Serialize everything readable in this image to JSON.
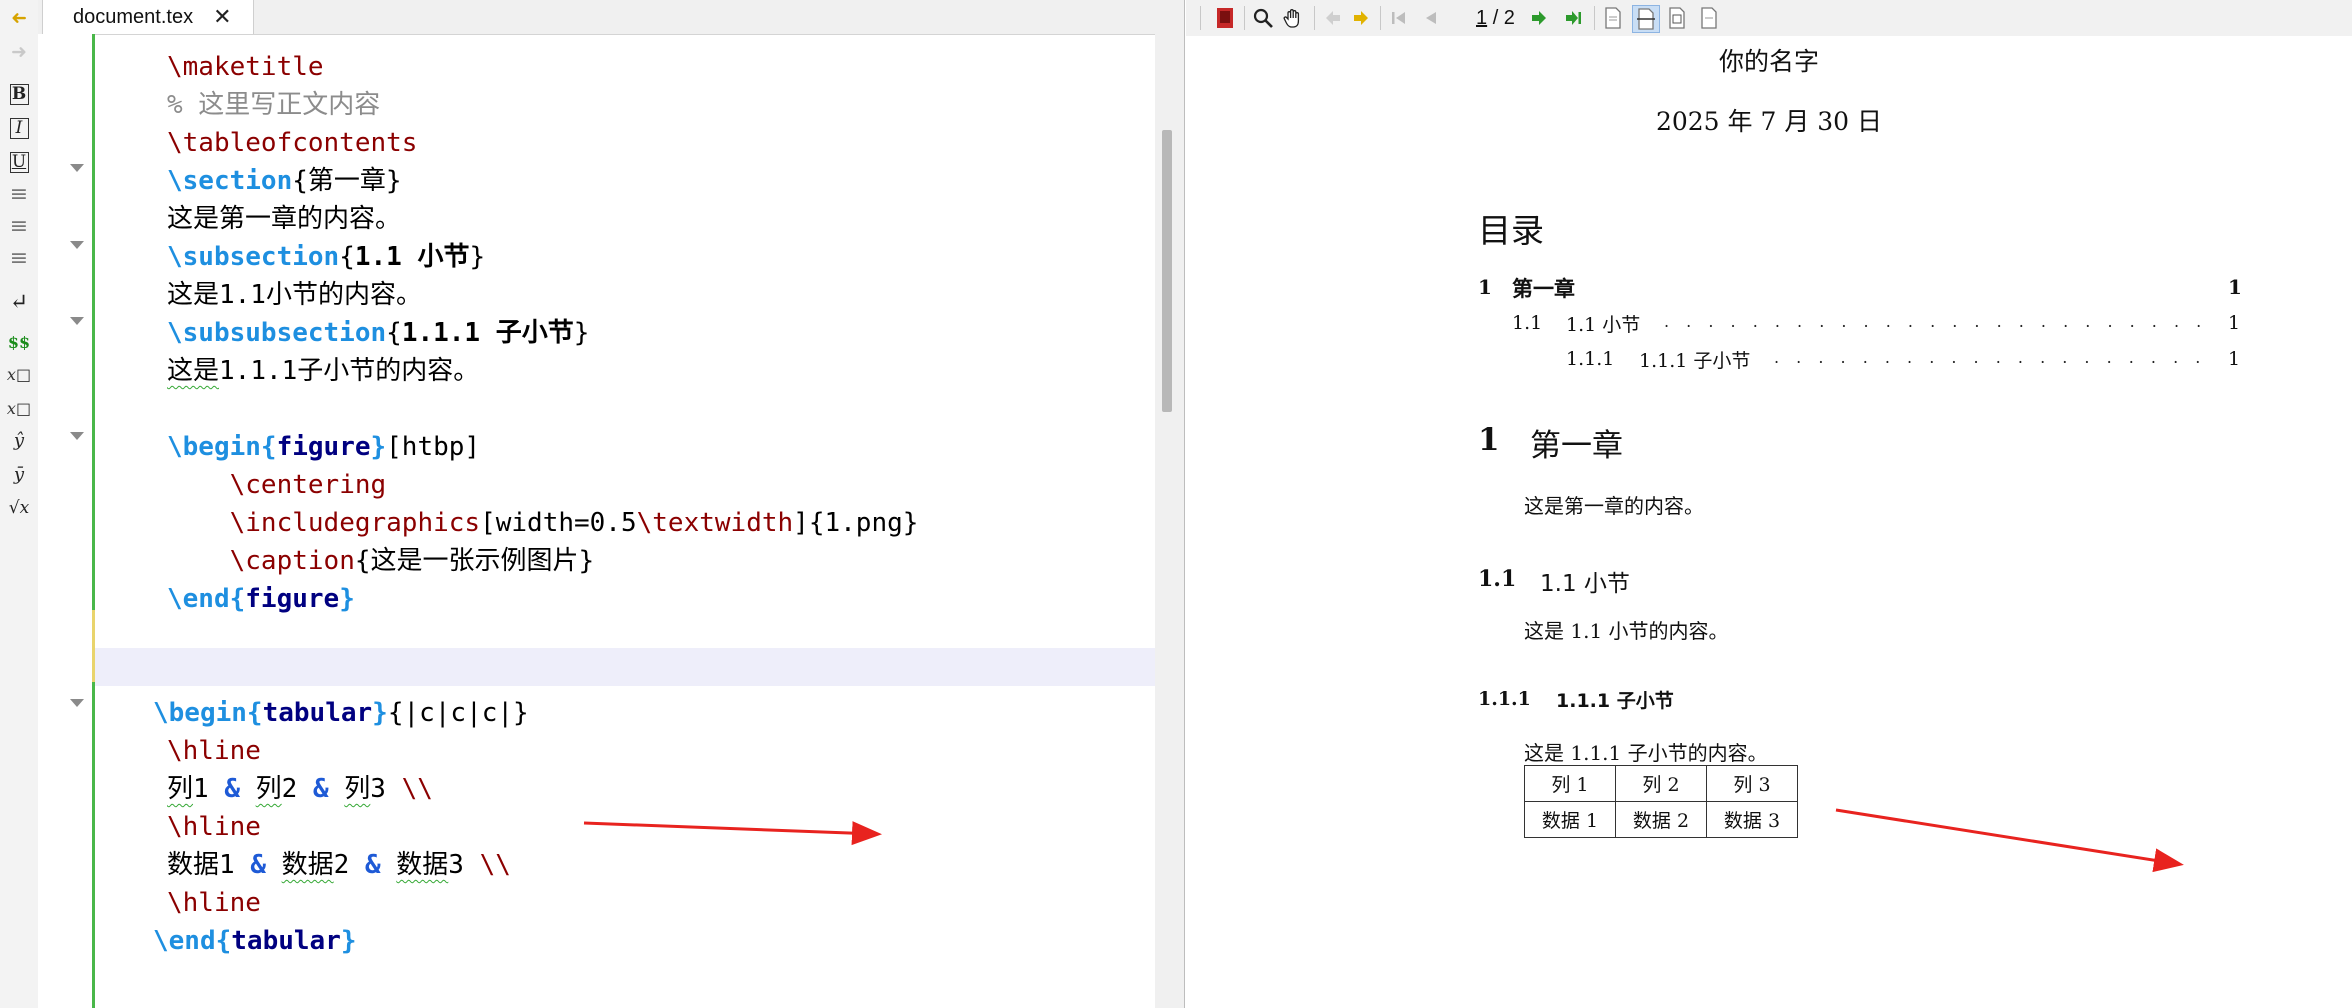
{
  "tab": {
    "filename": "document.tex",
    "close_glyph": "✕"
  },
  "left_toolbar": {
    "items": [
      {
        "name": "back-arrow-icon",
        "glyph": "➜"
      },
      {
        "name": "forward-arrow-icon",
        "glyph": "➜"
      },
      {
        "name": "bold-icon",
        "glyph": "B"
      },
      {
        "name": "italic-icon",
        "glyph": "I"
      },
      {
        "name": "underline-icon",
        "glyph": "U"
      },
      {
        "name": "align-left-icon",
        "glyph": "≡"
      },
      {
        "name": "align-center-icon",
        "glyph": "≡"
      },
      {
        "name": "align-right-icon",
        "glyph": "≡"
      },
      {
        "name": "newline-icon",
        "glyph": "↵"
      },
      {
        "name": "math-dollar-icon",
        "glyph": "$$"
      },
      {
        "name": "subscript-icon",
        "glyph": "x□"
      },
      {
        "name": "superscript-icon",
        "glyph": "x□"
      },
      {
        "name": "hat-icon",
        "glyph": "ŷ"
      },
      {
        "name": "bar-icon",
        "glyph": "ȳ"
      },
      {
        "name": "sqrt-icon",
        "glyph": "√x"
      }
    ]
  },
  "editor": {
    "lines": [
      [
        {
          "t": "\\maketitle",
          "c": "cmd"
        }
      ],
      [
        {
          "t": "% 这里写正文内容",
          "c": "cmt"
        }
      ],
      [
        {
          "t": "\\tableofcontents",
          "c": "cmd"
        }
      ],
      [
        {
          "t": "\\section",
          "c": "kw"
        },
        {
          "t": "{",
          "c": ""
        },
        {
          "t": "第一章",
          "c": ""
        },
        {
          "t": "}",
          "c": ""
        }
      ],
      [
        {
          "t": "这是第一章的内容。",
          "c": ""
        }
      ],
      [
        {
          "t": "\\subsection",
          "c": "kw"
        },
        {
          "t": "{",
          "c": ""
        },
        {
          "t": "1.1 小节",
          "c": "bold"
        },
        {
          "t": "}",
          "c": ""
        }
      ],
      [
        {
          "t": "这是1.1小节的内容。",
          "c": ""
        }
      ],
      [
        {
          "t": "\\subsubsection",
          "c": "kw"
        },
        {
          "t": "{",
          "c": ""
        },
        {
          "t": "1.1.1 子小节",
          "c": "bold"
        },
        {
          "t": "}",
          "c": ""
        }
      ],
      [
        {
          "t": "这是",
          "c": "sq"
        },
        {
          "t": "1.1.1子小节的内容。",
          "c": ""
        }
      ],
      [],
      [
        {
          "t": "\\begin",
          "c": "kw"
        },
        {
          "t": "{",
          "c": "kw"
        },
        {
          "t": "figure",
          "c": "env"
        },
        {
          "t": "}",
          "c": "kw"
        },
        {
          "t": "[htbp]",
          "c": ""
        }
      ],
      [
        {
          "t": "    ",
          "c": ""
        },
        {
          "t": "\\centering",
          "c": "cmd"
        }
      ],
      [
        {
          "t": "    ",
          "c": ""
        },
        {
          "t": "\\includegraphics",
          "c": "cmd"
        },
        {
          "t": "[width=0.5",
          "c": ""
        },
        {
          "t": "\\textwidth",
          "c": "cmd"
        },
        {
          "t": "]{1.png}",
          "c": ""
        }
      ],
      [
        {
          "t": "    ",
          "c": ""
        },
        {
          "t": "\\caption",
          "c": "cmd"
        },
        {
          "t": "{这是一张示例图片}",
          "c": ""
        }
      ],
      [
        {
          "t": "\\end",
          "c": "kw"
        },
        {
          "t": "{",
          "c": "kw"
        },
        {
          "t": "figure",
          "c": "env"
        },
        {
          "t": "}",
          "c": "kw"
        }
      ],
      [],
      [],
      [
        {
          "t": "\\begin",
          "c": "kw"
        },
        {
          "t": "{",
          "c": "kw"
        },
        {
          "t": "tabular",
          "c": "env"
        },
        {
          "t": "}",
          "c": "kw"
        },
        {
          "t": "{|c|c|c|}",
          "c": ""
        }
      ],
      [
        {
          "t": "\\hline",
          "c": "cmd"
        }
      ],
      [
        {
          "t": "列",
          "c": "sq"
        },
        {
          "t": "1 ",
          "c": ""
        },
        {
          "t": "&",
          "c": "amp"
        },
        {
          "t": " ",
          "c": ""
        },
        {
          "t": "列",
          "c": "sq"
        },
        {
          "t": "2 ",
          "c": ""
        },
        {
          "t": "&",
          "c": "amp"
        },
        {
          "t": " ",
          "c": ""
        },
        {
          "t": "列",
          "c": "sq"
        },
        {
          "t": "3 ",
          "c": ""
        },
        {
          "t": "\\\\",
          "c": "bsl"
        }
      ],
      [
        {
          "t": "\\hline",
          "c": "cmd"
        }
      ],
      [
        {
          "t": "数据1 ",
          "c": ""
        },
        {
          "t": "&",
          "c": "amp"
        },
        {
          "t": " ",
          "c": ""
        },
        {
          "t": "数据",
          "c": "sq"
        },
        {
          "t": "2 ",
          "c": ""
        },
        {
          "t": "&",
          "c": "amp"
        },
        {
          "t": " ",
          "c": ""
        },
        {
          "t": "数据",
          "c": "sq"
        },
        {
          "t": "3 ",
          "c": ""
        },
        {
          "t": "\\\\",
          "c": "bsl"
        }
      ],
      [
        {
          "t": "\\hline",
          "c": "cmd"
        }
      ],
      [
        {
          "t": "\\end",
          "c": "kw"
        },
        {
          "t": "{",
          "c": "kw"
        },
        {
          "t": "tabular",
          "c": "env"
        },
        {
          "t": "}",
          "c": "kw"
        }
      ]
    ]
  },
  "viewer": {
    "page_current": "1",
    "page_total": "/ 2"
  },
  "pdf": {
    "author": "你的名字",
    "date": "2025 年 7 月 30 日",
    "toc_title": "目录",
    "toc": [
      {
        "num": "1",
        "title": "第一章",
        "page": "1"
      },
      {
        "num": "1.1",
        "title": "1.1 小节",
        "page": "1"
      },
      {
        "num": "1.1.1",
        "title": "1.1.1 子小节",
        "page": "1"
      }
    ],
    "section": {
      "num": "1",
      "title": "第一章",
      "body": "这是第一章的内容。"
    },
    "subsection": {
      "num": "1.1",
      "title": "1.1 小节",
      "body": "这是 1.1 小节的内容。"
    },
    "subsubsection": {
      "num": "1.1.1",
      "title": "1.1.1 子小节",
      "body": "这是 1.1.1 子小节的内容。"
    },
    "table": {
      "header": [
        "列 1",
        "列 2",
        "列 3"
      ],
      "rows": [
        [
          "数据 1",
          "数据 2",
          "数据 3"
        ]
      ]
    }
  },
  "colors": {
    "annotation_arrow": "#e8231f",
    "change_bar": "#49b749",
    "current_line": "#eeeefa"
  }
}
